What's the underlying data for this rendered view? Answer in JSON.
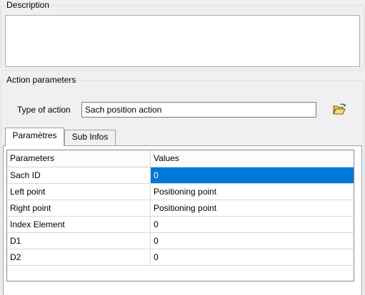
{
  "description": {
    "legend": "Description",
    "text": ""
  },
  "action_parameters": {
    "legend": "Action parameters",
    "type_label": "Type of action",
    "type_value": "Sach position action",
    "browse_icon": "open-folder-icon"
  },
  "tabs": [
    {
      "label": "Paramètres",
      "active": true
    },
    {
      "label": "Sub Infos",
      "active": false
    }
  ],
  "grid": {
    "headers": [
      "Parameters",
      "Values"
    ],
    "rows": [
      {
        "param": "Sach ID",
        "value": "0",
        "selected": true
      },
      {
        "param": "Left point",
        "value": "Positioning point"
      },
      {
        "param": "Right point",
        "value": "Positioning point"
      },
      {
        "param": "Index Element",
        "value": "0"
      },
      {
        "param": "D1",
        "value": "0"
      },
      {
        "param": "D2",
        "value": "0"
      }
    ]
  },
  "colors": {
    "selection": "#0078d7",
    "background": "#f0f0f0"
  }
}
